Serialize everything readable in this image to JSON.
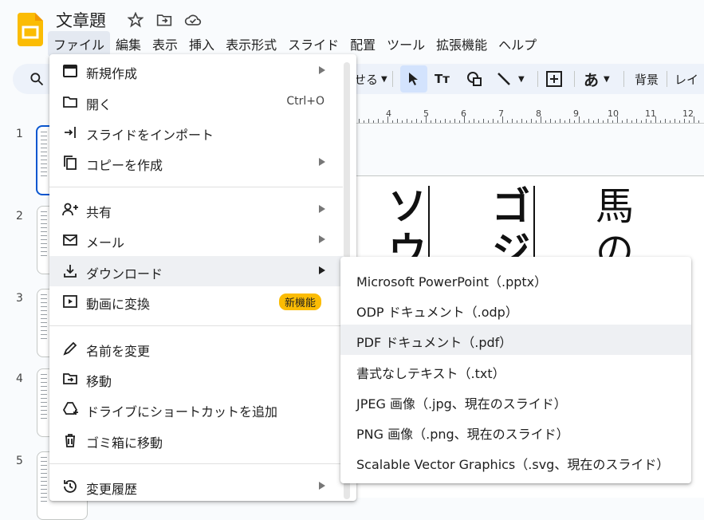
{
  "doc": {
    "title": "文章題"
  },
  "menubar": {
    "items": [
      "ファイル",
      "編集",
      "表示",
      "挿入",
      "表示形式",
      "スライド",
      "配置",
      "ツール",
      "拡張機能",
      "ヘルプ"
    ]
  },
  "toolbar": {
    "partial_left": "せる",
    "bg_label": "背景",
    "partial_right": "レイ",
    "kana": "あ"
  },
  "ruler": {
    "labels": [
      "4",
      "5",
      "6",
      "7",
      "8",
      "9",
      "10",
      "11",
      "12"
    ]
  },
  "slides": {
    "numbers": [
      "1",
      "2",
      "3",
      "4",
      "5"
    ]
  },
  "canvas": {
    "col1": "ソウ",
    "col2": "ゴジ",
    "col3": "馬の"
  },
  "file_menu": {
    "items": [
      {
        "label": "新規作成",
        "icon": "slides-icon"
      },
      {
        "label": "開く",
        "shortcut": "Ctrl+O",
        "icon": "folder-icon"
      },
      {
        "label": "スライドをインポート",
        "icon": "import-icon"
      },
      {
        "label": "コピーを作成",
        "icon": "copy-icon"
      },
      {
        "label": "共有",
        "icon": "person-add-icon"
      },
      {
        "label": "メール",
        "icon": "mail-icon"
      },
      {
        "label": "ダウンロード",
        "icon": "download-icon"
      },
      {
        "label": "動画に変換",
        "badge": "新機能",
        "icon": "video-icon"
      },
      {
        "label": "名前を変更",
        "icon": "pencil-icon"
      },
      {
        "label": "移動",
        "icon": "move-folder-icon"
      },
      {
        "label": "ドライブにショートカットを追加",
        "icon": "drive-shortcut-icon"
      },
      {
        "label": "ゴミ箱に移動",
        "icon": "trash-icon"
      },
      {
        "label": "変更履歴",
        "icon": "history-icon"
      }
    ]
  },
  "download_submenu": {
    "items": [
      "Microsoft PowerPoint（.pptx）",
      "ODP ドキュメント（.odp）",
      "PDF ドキュメント（.pdf）",
      "書式なしテキスト（.txt）",
      "JPEG 画像（.jpg、現在のスライド）",
      "PNG 画像（.png、現在のスライド）",
      "Scalable Vector Graphics（.svg、現在のスライド）"
    ]
  },
  "colors": {
    "accent": "#0b57d0",
    "logo": "#fbbc04",
    "badge": "#fbbc04"
  }
}
